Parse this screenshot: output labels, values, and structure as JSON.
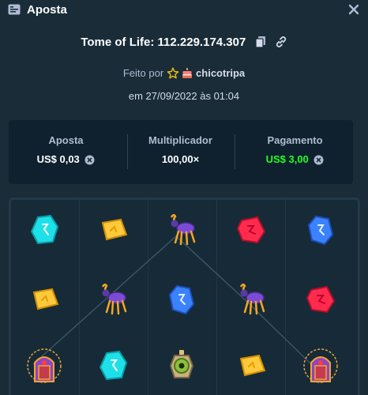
{
  "header": {
    "title": "Aposta",
    "icon": "receipt-icon",
    "close_icon": "close-icon"
  },
  "game": {
    "title": "Tome of Life: 112.229.174.307",
    "copy_icon": "copy-icon",
    "link_icon": "link-icon"
  },
  "made_by": {
    "prefix": "Feito por",
    "username": "chicotripa",
    "vip_icon": "star-icon",
    "badge_icon": "cake-icon"
  },
  "date": "em 27/09/2022 às 01:04",
  "stats": {
    "bet": {
      "label": "Aposta",
      "value": "US$ 0,03",
      "icon": "coin-icon"
    },
    "multiplier": {
      "label": "Multiplicador",
      "value": "100,00×"
    },
    "payout": {
      "label": "Pagamento",
      "value": "US$ 3,00",
      "icon": "coin-icon",
      "color": "#1fff20"
    }
  },
  "board": {
    "rows": [
      [
        "cyan-gem",
        "gold-gem",
        "spider-creature",
        "red-gem",
        "blue-gem"
      ],
      [
        "gold-gem",
        "spider-creature",
        "blue-gem",
        "spider-creature",
        "red-gem"
      ],
      [
        "tome-door",
        "cyan-gem",
        "eye-idol",
        "gold-gem",
        "tome-door"
      ]
    ]
  },
  "colors": {
    "background": "#1a2c38",
    "panel": "#0f212e",
    "label": "#b1bad3",
    "payout": "#1fff20"
  }
}
